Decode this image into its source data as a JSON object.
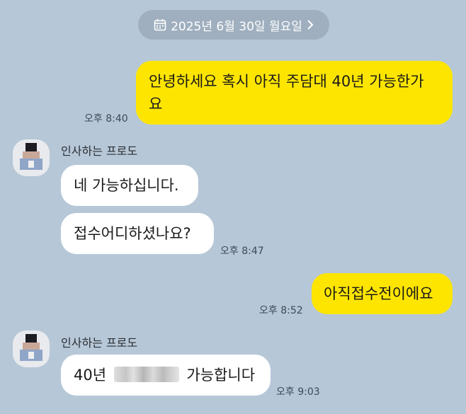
{
  "date_header": {
    "text": "2025년 6월 30일 월요일",
    "icon": "calendar-icon",
    "chevron": "chevron-right-icon"
  },
  "messages": [
    {
      "from": "me",
      "text_line1": "안녕하세요 혹시 아직 주담대 40년 가능한가",
      "text_line2": "요",
      "time": "오후 8:40"
    },
    {
      "from": "other",
      "sender": "인사하는 프로도"
    },
    {
      "from": "other",
      "text": "네 가능하십니다."
    },
    {
      "from": "other",
      "text": "접수어디하셨나요?",
      "time": "오후 8:47"
    },
    {
      "from": "me",
      "text": "아직접수전이에요",
      "time": "오후 8:52"
    },
    {
      "from": "other",
      "sender": "인사하는 프로도"
    },
    {
      "from": "other",
      "text_before": "40년",
      "text_after": "가능합니다",
      "time": "오후 9:03"
    }
  ],
  "colors": {
    "background": "#b6c7d7",
    "my_bubble": "#fee500",
    "their_bubble": "#ffffff",
    "date_pill": "#9fafbf"
  }
}
